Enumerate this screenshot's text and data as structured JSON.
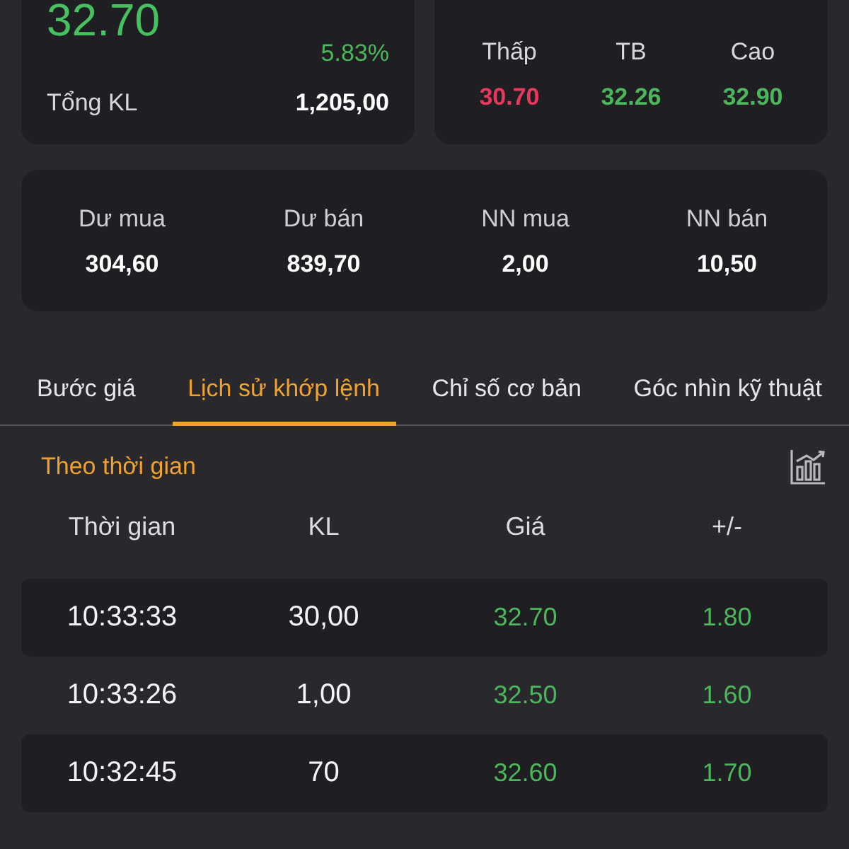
{
  "quote": {
    "price": "32.70",
    "change_percent": "5.83%",
    "volume_label": "Tổng KL",
    "volume": "1,205,00"
  },
  "range": [
    {
      "label": "Thấp",
      "value": "30.70",
      "color": "#e8385c"
    },
    {
      "label": "TB",
      "value": "32.26",
      "color": "#4cb65a"
    },
    {
      "label": "Cao",
      "value": "32.90",
      "color": "#4cb65a"
    }
  ],
  "flow": [
    {
      "label": "Dư mua",
      "value": "304,60"
    },
    {
      "label": "Dư bán",
      "value": "839,70"
    },
    {
      "label": "NN mua",
      "value": "2,00"
    },
    {
      "label": "NN bán",
      "value": "10,50"
    }
  ],
  "tabs": [
    {
      "label": "Bước giá",
      "selected": false
    },
    {
      "label": "Lịch sử khớp lệnh",
      "selected": true
    },
    {
      "label": "Chỉ số cơ bản",
      "selected": false
    },
    {
      "label": "Góc nhìn kỹ thuật",
      "selected": false
    }
  ],
  "section": {
    "title": "Theo thời gian"
  },
  "table": {
    "columns": [
      "Thời gian",
      "KL",
      "Giá",
      "+/-"
    ],
    "rows": [
      {
        "time": "10:33:33",
        "volume": "30,00",
        "price": "32.70",
        "change": "1.80"
      },
      {
        "time": "10:33:26",
        "volume": "1,00",
        "price": "32.50",
        "change": "1.60"
      },
      {
        "time": "10:32:45",
        "volume": "70",
        "price": "32.60",
        "change": "1.70"
      }
    ]
  }
}
